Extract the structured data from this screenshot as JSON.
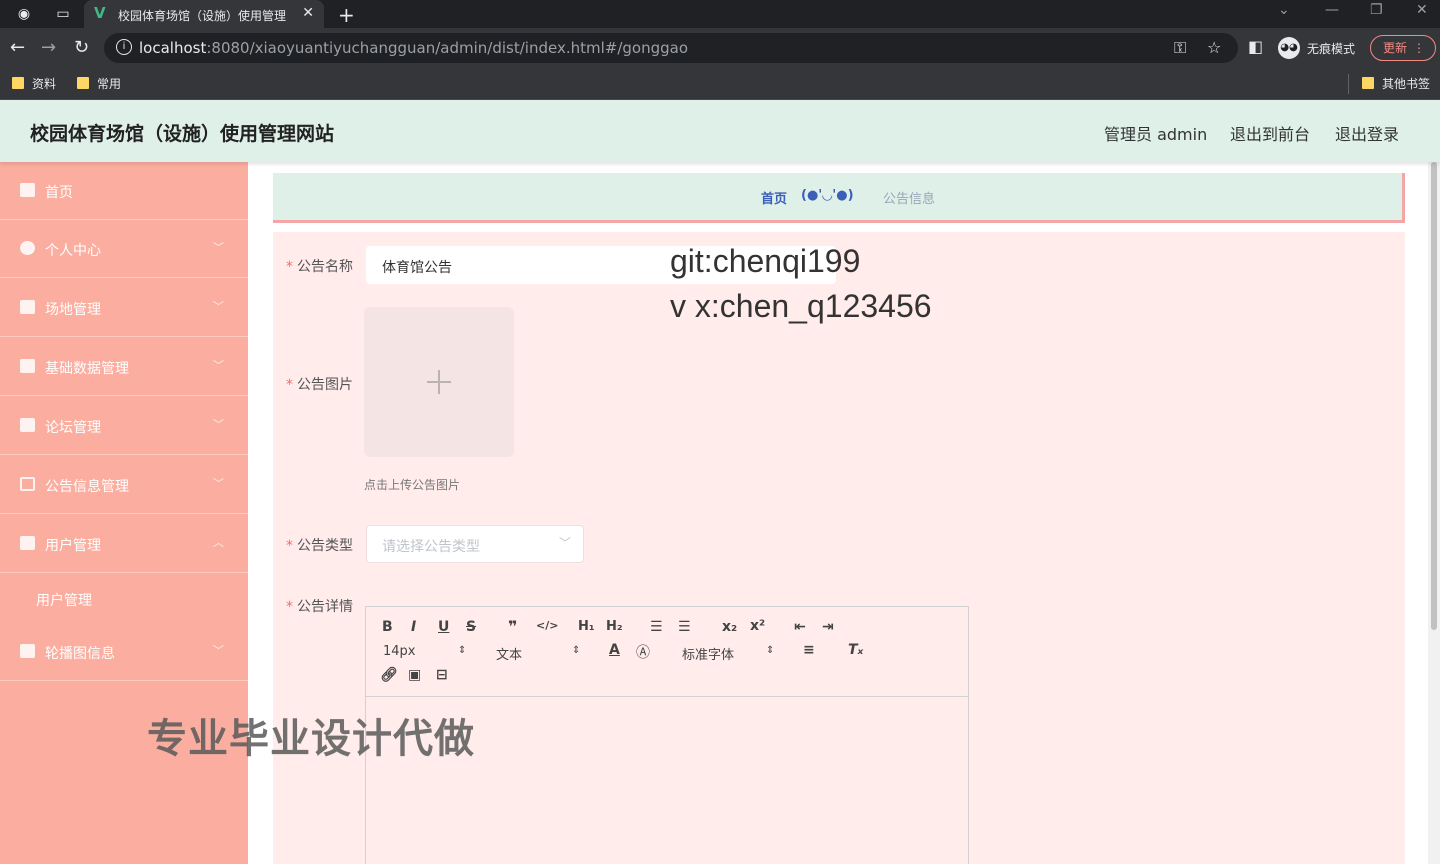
{
  "browser": {
    "tab_title": "校园体育场馆（设施）使用管理",
    "url_host": "localhost",
    "url_rest": ":8080/xiaoyuantiyuchangguan/admin/dist/index.html#/gonggao",
    "incognito_label": "无痕模式",
    "update_label": "更新",
    "bookmarks": [
      "资料",
      "常用"
    ],
    "other_bookmarks": "其他书签"
  },
  "header": {
    "title": "校园体育场馆（设施）使用管理网站",
    "user": "管理员 admin",
    "back_to_front": "退出到前台",
    "logout": "退出登录"
  },
  "sidebar": {
    "items": [
      {
        "label": "首页",
        "icon": "home-icon"
      },
      {
        "label": "个人中心",
        "icon": "user-icon"
      },
      {
        "label": "场地管理",
        "icon": "building-icon"
      },
      {
        "label": "基础数据管理",
        "icon": "data-icon"
      },
      {
        "label": "论坛管理",
        "icon": "forum-icon"
      },
      {
        "label": "公告信息管理",
        "icon": "notice-icon"
      },
      {
        "label": "用户管理",
        "icon": "chart-icon"
      },
      {
        "label": "轮播图信息",
        "icon": "image-icon"
      }
    ],
    "submenu": [
      "用户管理"
    ]
  },
  "breadcrumb": {
    "home": "首页",
    "emote": "(●'◡'●)",
    "current": "公告信息"
  },
  "form": {
    "name_label": "公告名称",
    "name_value": "体育馆公告",
    "image_label": "公告图片",
    "upload_hint": "点击上传公告图片",
    "type_label": "公告类型",
    "type_placeholder": "请选择公告类型",
    "detail_label": "公告详情"
  },
  "editor": {
    "font_size": "14px",
    "header_select": "文本",
    "font_family": "标准字体"
  },
  "watermarks": {
    "git": "git:chenqi199",
    "vx": "v x:chen_q123456",
    "cn": "专业毕业设计代做"
  },
  "colors": {
    "sidebar_bg": "#fbaea0",
    "header_bg": "#dff0e9",
    "form_bg": "#ffeceb",
    "required": "#f56c6c"
  }
}
